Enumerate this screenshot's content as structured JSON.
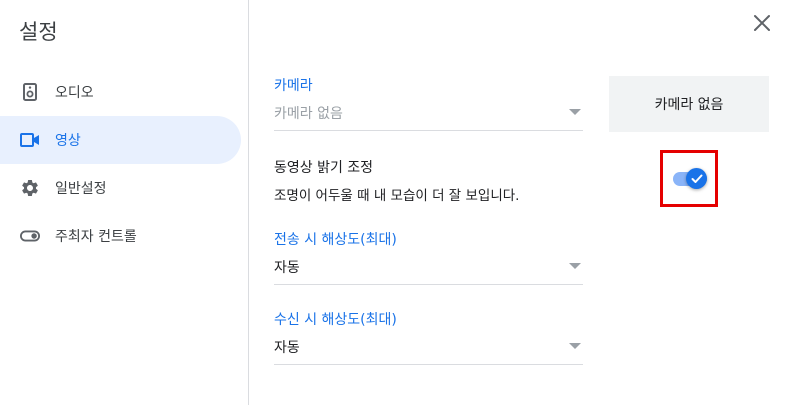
{
  "dialog": {
    "title": "설정"
  },
  "sidebar": {
    "items": [
      {
        "label": "오디오",
        "icon": "speaker-icon",
        "active": false
      },
      {
        "label": "영상",
        "icon": "videocam-icon",
        "active": true
      },
      {
        "label": "일반설정",
        "icon": "gear-icon",
        "active": false
      },
      {
        "label": "주최자 컨트롤",
        "icon": "toggle-icon",
        "active": false
      }
    ]
  },
  "camera": {
    "label": "카메라",
    "value": "카메라 없음",
    "preview_text": "카메라 없음"
  },
  "brightness": {
    "title": "동영상 밝기 조정",
    "description": "조명이 어두울 때 내 모습이 더 잘 보입니다.",
    "enabled": true
  },
  "send_resolution": {
    "label": "전송 시 해상도(최대)",
    "value": "자동"
  },
  "receive_resolution": {
    "label": "수신 시 해상도(최대)",
    "value": "자동"
  },
  "colors": {
    "accent": "#1a73e8",
    "active_bg": "#e8f0fe",
    "highlight_box": "#e50000"
  }
}
